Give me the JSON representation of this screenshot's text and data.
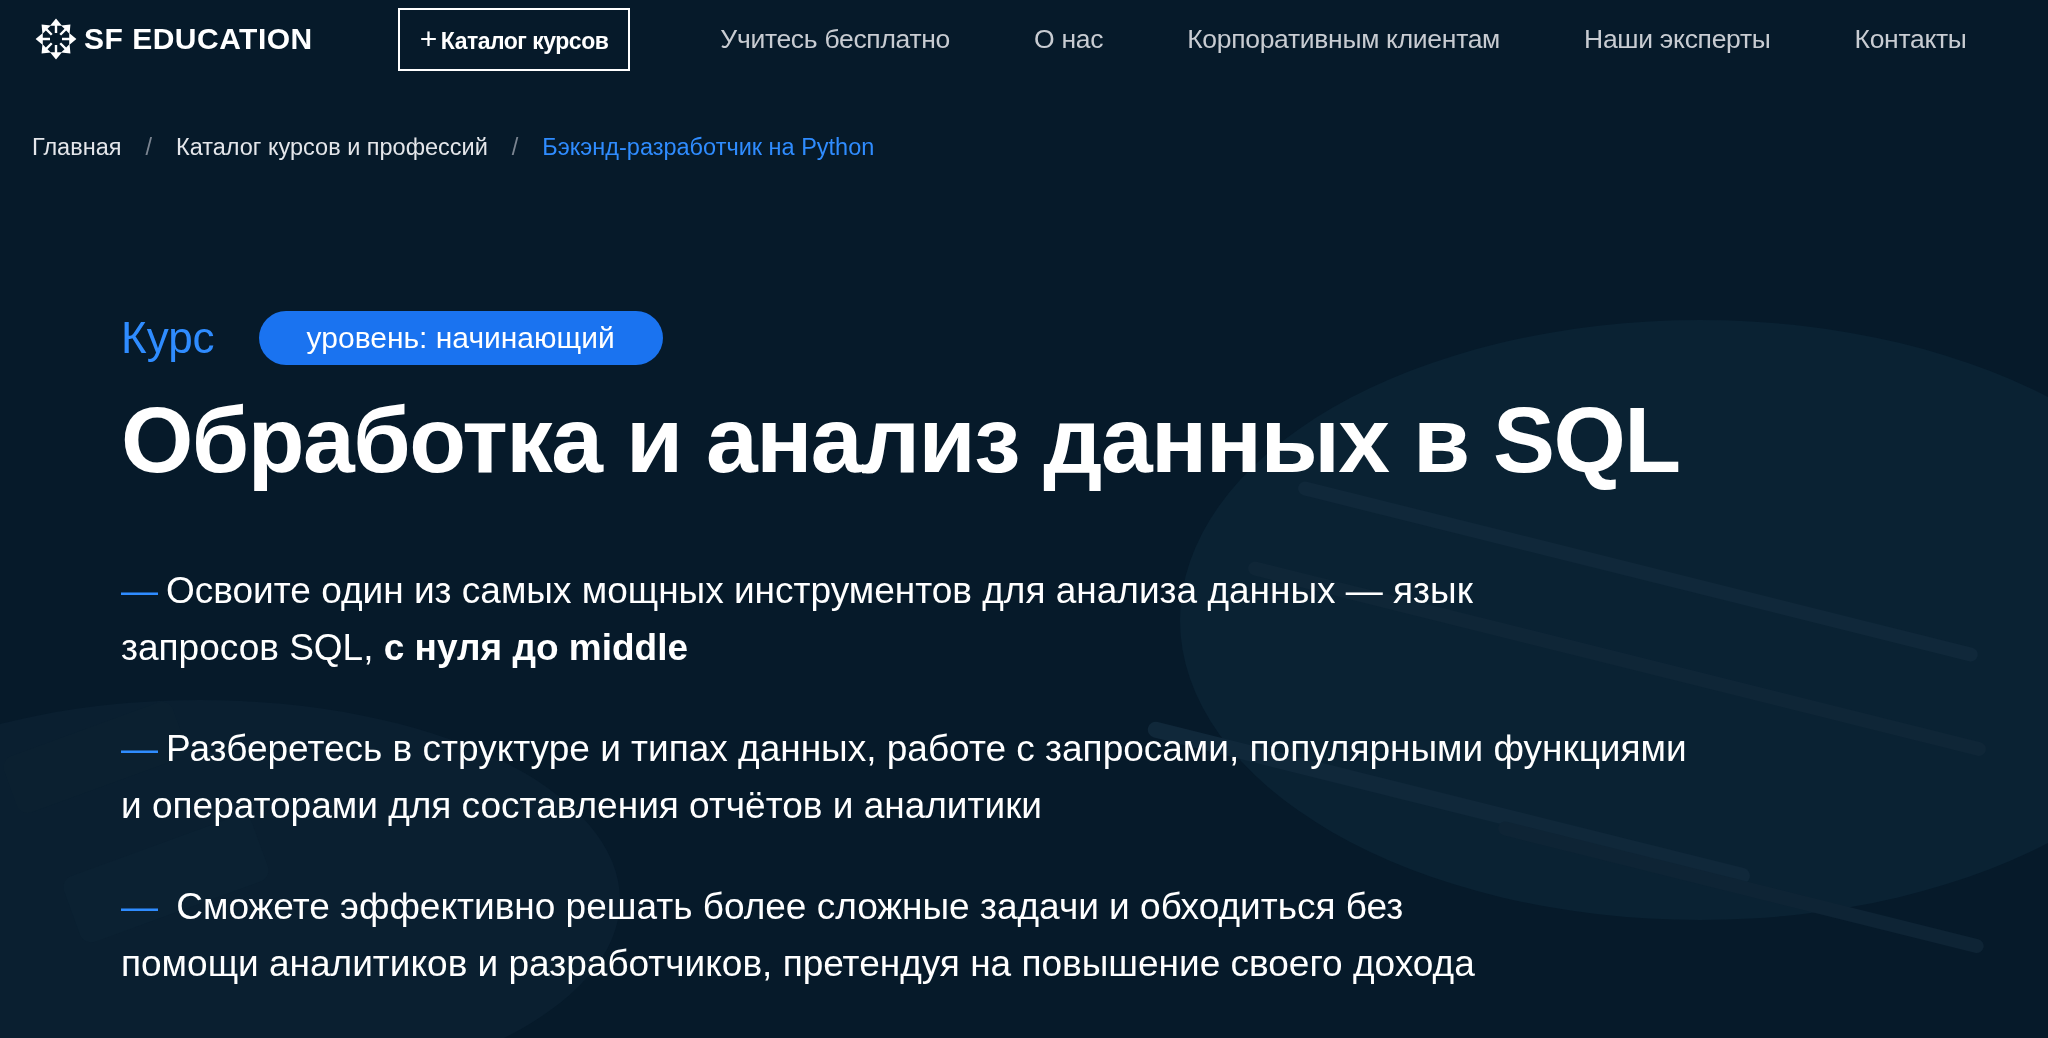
{
  "header": {
    "logo": "SF EDUCATION",
    "catalog_button": {
      "plus": "+",
      "label": "Каталог курсов"
    },
    "nav": [
      "Учитесь бесплатно",
      "О нас",
      "Корпоративным клиентам",
      "Наши эксперты",
      "Контакты"
    ]
  },
  "breadcrumbs": [
    {
      "label": "Главная",
      "current": false
    },
    {
      "label": "Каталог курсов и профессий",
      "current": false
    },
    {
      "label": "Бэкэнд-разработчик на Python",
      "current": true
    }
  ],
  "breadcrumb_separator": "/",
  "hero": {
    "kind": "picture",
    "type_label": "Курс",
    "level_badge": "уровень: начинающий",
    "title": "Обработка и анализ данных в SQL",
    "bullets": [
      {
        "dash": "—",
        "lines": [
          "Освоите один из самых мощных инструментов для анализа данных — язык",
          "запросов SQL, **с нуля до middle**"
        ]
      },
      {
        "dash": "—",
        "lines": [
          "Разберетесь в структуре и типах данных, работе с запросами, популярными функциями",
          "и операторами для составления отчётов и аналитики"
        ]
      },
      {
        "dash": "—",
        "lines": [
          " Сможете эффективно решать более сложные задачи и обходиться без",
          "помощи аналитиков и разработчиков, претендуя на повышение своего дохода"
        ]
      }
    ]
  }
}
